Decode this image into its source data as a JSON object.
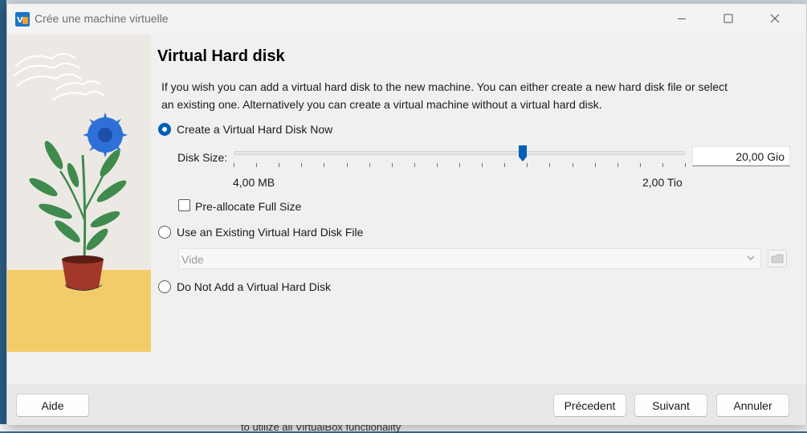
{
  "window": {
    "title": "Crée une machine virtuelle"
  },
  "page": {
    "heading": "Virtual Hard disk",
    "description": "If you wish you can add a virtual hard disk to the new machine. You can either create a new hard disk file or select an existing one. Alternatively you can create a virtual machine without a virtual hard disk."
  },
  "options": {
    "create_new": {
      "label": "Create a Virtual Hard Disk Now",
      "selected": true
    },
    "use_existing": {
      "label": "Use an Existing Virtual Hard Disk File",
      "selected": false
    },
    "do_not_add": {
      "label": "Do Not Add a Virtual Hard Disk",
      "selected": false
    }
  },
  "disk_size": {
    "label": "Disk Size:",
    "value": "20,00 Gio",
    "min_label": "4,00 MB",
    "max_label": "2,00 Tio",
    "slider_fraction": 0.64
  },
  "preallocate": {
    "label": "Pre-allocate Full Size",
    "checked": false
  },
  "existing_file": {
    "selected": "Vide",
    "enabled": false
  },
  "buttons": {
    "help": "Aide",
    "previous": "Précedent",
    "next": "Suivant",
    "cancel": "Annuler"
  },
  "background": {
    "partial_text": "to utilize all VirtualBox functionality"
  },
  "colors": {
    "accent": "#005fb8",
    "illustration_sky": "#ece9e4",
    "illustration_ground": "#f3cc6a",
    "flower": "#2f6fd8",
    "leaves": "#3f8a4d",
    "pot": "#a1382a"
  }
}
